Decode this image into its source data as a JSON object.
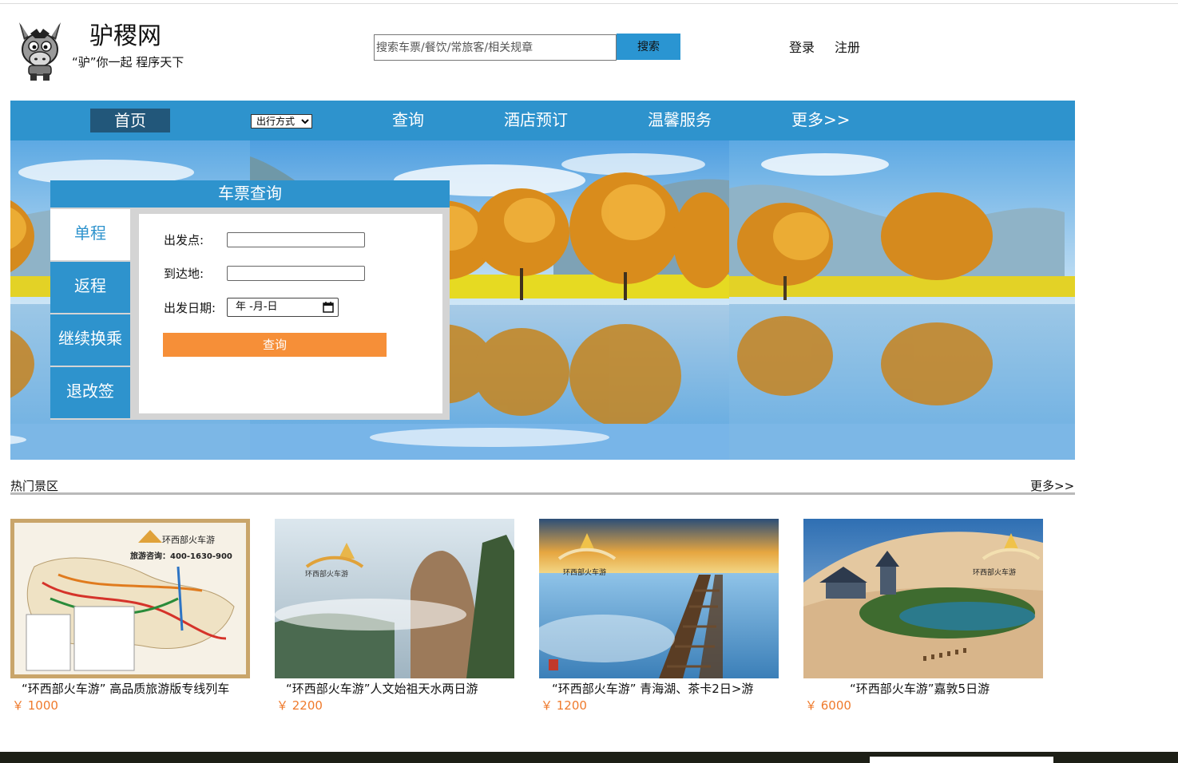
{
  "header": {
    "site_title": "驴稷网",
    "slogan": "“驴”你一起 程序天下",
    "search_placeholder": "搜索车票/餐饮/常旅客/相关规章",
    "search_button": "搜索",
    "login": "登录",
    "register": "注册",
    "logo_icon": "donkey-logo-icon"
  },
  "nav": {
    "home": "首页",
    "travel_mode_select": "出行方式",
    "query": "查询",
    "hotel": "酒店预订",
    "service": "温馨服务",
    "more": "更多>>"
  },
  "ticket_panel": {
    "title": "车票查询",
    "tabs": [
      "单程",
      "返程",
      "继续换乘",
      "退改签"
    ],
    "from_label": "出发点:",
    "to_label": "到达地:",
    "date_label": "出发日期:",
    "date_placeholder": "年 -月-日",
    "query_button": "查询"
  },
  "hot_spots": {
    "title": "热门景区",
    "more": "更多>>",
    "items": [
      {
        "title": "“环西部火车游” 高品质旅游版专线列车",
        "price": "￥ 1000"
      },
      {
        "title": "“环西部火车游”人文始祖天水两日游",
        "price": "￥ 2200"
      },
      {
        "title": "“环西部火车游” 青海湖、茶卡2日>游",
        "price": "￥ 1200"
      },
      {
        "title": "“环西部火车游”嘉敦5日游",
        "price": "￥ 6000"
      }
    ],
    "image_text": {
      "brand": "环西部火车游",
      "hotline": "旅游咨询：400-1630-900"
    }
  },
  "colors": {
    "nav_blue": "#2e93cd",
    "nav_active": "#22577a",
    "accent_orange": "#f68f38",
    "price_orange": "#ef7a2c"
  }
}
